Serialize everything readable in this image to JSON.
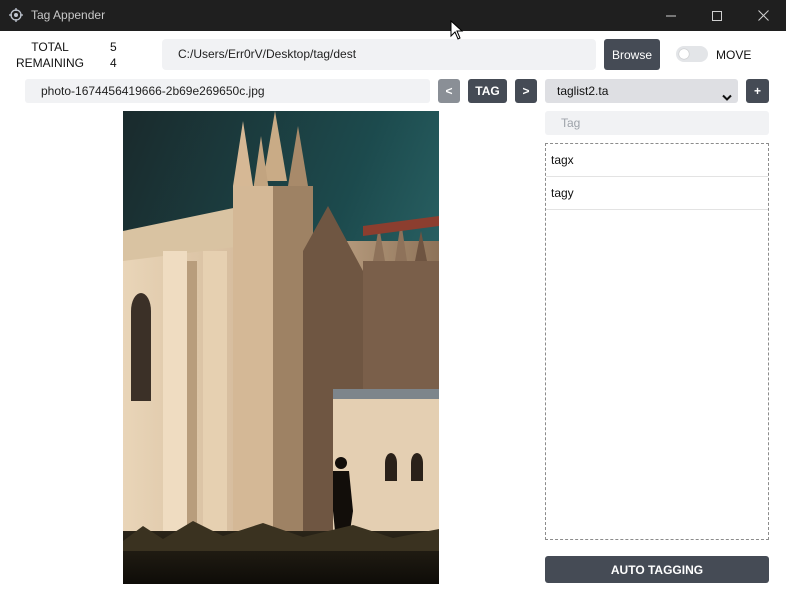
{
  "window": {
    "title": "Tag Appender"
  },
  "stats": {
    "total_label": "TOTAL",
    "total_value": "5",
    "remaining_label": "REMAINING",
    "remaining_value": "4"
  },
  "dest": {
    "path": "C:/Users/Err0rV/Desktop/tag/dest",
    "browse_label": "Browse"
  },
  "move": {
    "label": "MOVE",
    "enabled": false
  },
  "nav": {
    "filename": "photo-1674456419666-2b69e269650c.jpg",
    "prev_label": "<",
    "tag_label": "TAG",
    "next_label": ">"
  },
  "taglist": {
    "selected": "taglist2.ta",
    "add_label": "+"
  },
  "tag_input": {
    "placeholder": "Tag"
  },
  "tags": [
    "tagx",
    "tagy"
  ],
  "auto_button": "AUTO TAGGING",
  "colors": {
    "titlebar": "#1f1f1f",
    "button": "#454b55",
    "field": "#f1f2f4"
  }
}
